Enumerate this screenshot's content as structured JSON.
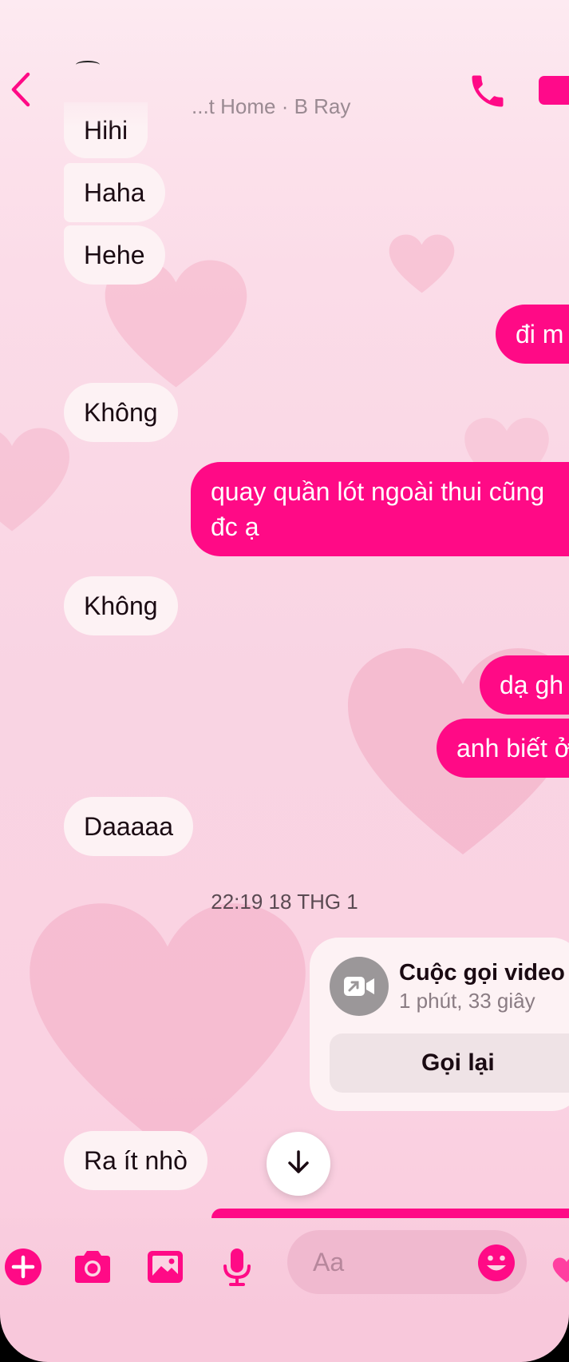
{
  "header": {
    "subtitle": "...t Home · B Ray"
  },
  "messages": [
    {
      "dir": "in",
      "text": "Hihi"
    },
    {
      "dir": "in",
      "text": "Haha"
    },
    {
      "dir": "in",
      "text": "Hehe"
    },
    {
      "dir": "out",
      "text": "đi m"
    },
    {
      "dir": "in",
      "text": "Không"
    },
    {
      "dir": "out",
      "text_line1": "quay quần lót ngoài thui cũng",
      "text_line2": "đc ạ"
    },
    {
      "dir": "in",
      "text": "Không"
    },
    {
      "dir": "out",
      "text": "dạ gh"
    },
    {
      "dir": "out",
      "text": "anh biết ở"
    },
    {
      "dir": "in",
      "text": "Daaaaa"
    },
    {
      "dir": "in",
      "text": "Ra ít nhò"
    }
  ],
  "timestamp": "22:19 18 THG 1",
  "call_card": {
    "title": "Cuộc gọi video",
    "duration": "1 phút, 33 giây",
    "callback_label": "Gọi lại"
  },
  "composer": {
    "placeholder": "Aa"
  },
  "colors": {
    "accent": "#ff0a86",
    "incoming_bubble": "#fdf2f4",
    "background": "#fbdce8"
  },
  "icons": {
    "back": "chevron-left-icon",
    "call": "phone-icon",
    "video": "video-camera-icon",
    "plus": "plus-icon",
    "camera": "camera-icon",
    "gallery": "image-icon",
    "mic": "microphone-icon",
    "emoji": "smiley-icon",
    "send": "heart-icon",
    "scroll": "arrow-down-icon"
  }
}
